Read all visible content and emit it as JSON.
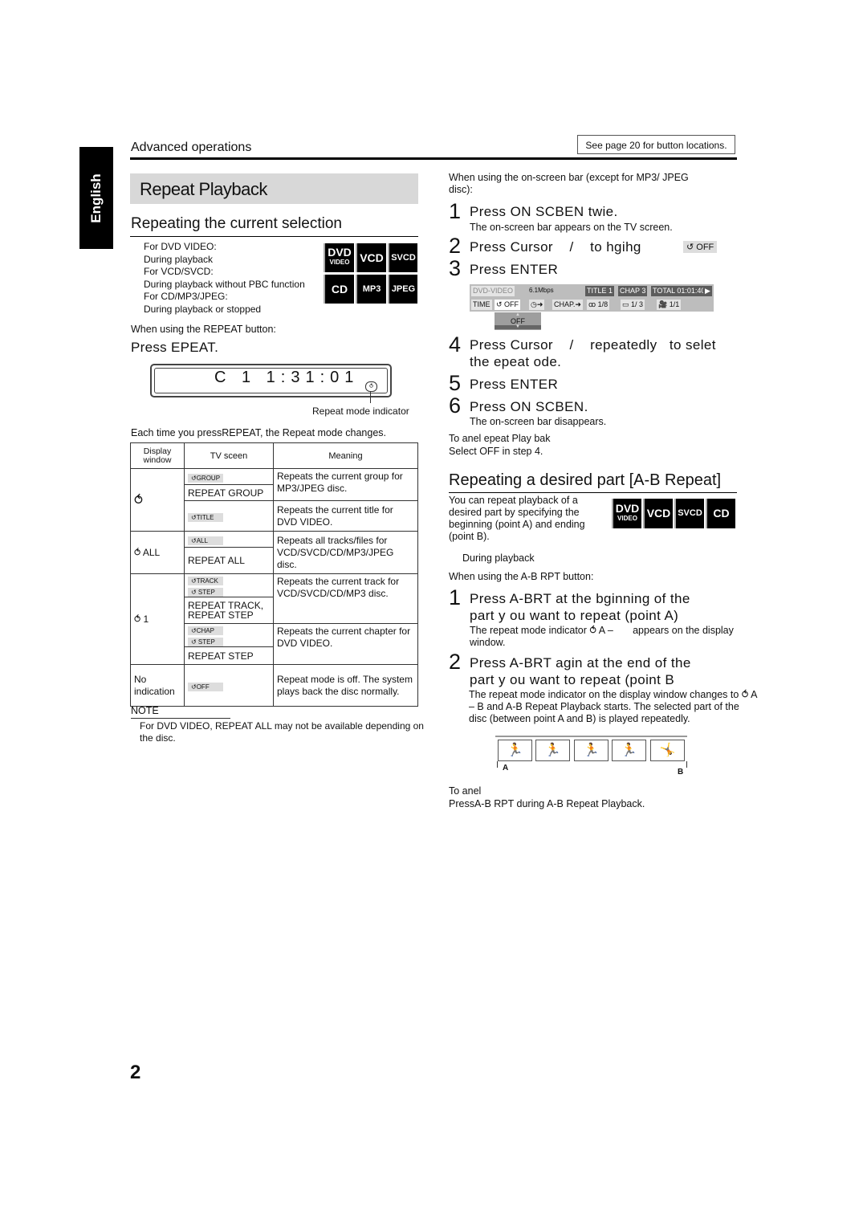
{
  "language_tab": "English",
  "section": "Advanced operations",
  "see_page_note": "See page 20 for button locations.",
  "page_title": "Repeat Playback",
  "page_number": "2",
  "left": {
    "heading": "Repeating the current selection",
    "conditions": [
      "For DVD VIDEO:",
      "During playback",
      "For VCD/SVCD:",
      "During playback without PBC function",
      "For CD/MP3/JPEG:",
      "During playback or stopped"
    ],
    "disc_badges": [
      {
        "main": "DVD",
        "sub": "VIDEO"
      },
      {
        "main": "VCD",
        "sub": ""
      },
      {
        "main": "SVCD",
        "sub": ""
      },
      {
        "main": "CD",
        "sub": ""
      },
      {
        "main": "MP3",
        "sub": ""
      },
      {
        "main": "JPEG",
        "sub": ""
      }
    ],
    "when_using": "When using the REPEAT button:",
    "press_repeat": "Press EPEAT.",
    "lcd_text": "C 1 1:31:01",
    "lcd_indicator_label": "Repeat mode indicator",
    "each_time": "Each time you pressREPEAT, the Repeat mode changes.",
    "table": {
      "headers": [
        "Display window",
        "TV sceen",
        "Meaning"
      ],
      "groups": [
        {
          "display": "⥀",
          "rows": [
            {
              "tv_chip": "↺GROUP",
              "tv_text": "REPEAT GROUP",
              "meaning": "Repeats the current group for MP3/JPEG disc."
            },
            {
              "tv_chip": "↺TITLE",
              "tv_text": "",
              "meaning": "Repeats the current title for DVD VIDEO."
            }
          ]
        },
        {
          "display": "⥀ ALL",
          "rows": [
            {
              "tv_chip": "↺ALL",
              "tv_text": "REPEAT ALL",
              "meaning": "Repeats all tracks/files for VCD/SVCD/CD/MP3/JPEG disc."
            }
          ]
        },
        {
          "display": "⥀ 1",
          "rows": [
            {
              "tv_chip": "↺TRACK",
              "tv_chip2": "↺ STEP",
              "tv_text": "REPEAT TRACK, REPEAT STEP",
              "meaning": "Repeats the current track for VCD/SVCD/CD/MP3 disc."
            },
            {
              "tv_chip": "↺CHAP",
              "tv_chip2": "↺ STEP",
              "tv_text": "REPEAT STEP",
              "meaning": "Repeats the current chapter for DVD VIDEO."
            }
          ]
        },
        {
          "display": "No indication",
          "rows": [
            {
              "tv_chip": "↺OFF",
              "tv_text": "",
              "meaning": "Repeat mode is off. The system plays back the disc normally."
            }
          ]
        }
      ]
    },
    "note_label": "NOTE",
    "note_text": "For DVD VIDEO, REPEAT ALL may not be available depending on the disc."
  },
  "right": {
    "intro": "When using the on-screen bar (except for MP3/ JPEG disc):",
    "steps": [
      {
        "num": "1",
        "text": "Press ON SCBEN twie.",
        "sub": "The on-screen bar appears on the TV screen."
      },
      {
        "num": "2",
        "text": "Press Cursor    /    to hgihg",
        "chip": "↺ OFF"
      },
      {
        "num": "3",
        "text": "Press ENTER"
      },
      {
        "num": "4",
        "text": "Press Cursor    /    repeatedly   to selet",
        "text2": "the epeat ode."
      },
      {
        "num": "5",
        "text": "Press ENTER"
      },
      {
        "num": "6",
        "text": "Press ON SCBEN.",
        "sub": "The on-screen bar disappears."
      }
    ],
    "osd": {
      "disc": "DVD-VIDEO",
      "rate": "6.1Mbps",
      "title": "TITLE  1",
      "chap": "CHAP  3",
      "total": "TOTAL 01:01:40",
      "row2": [
        "TIME",
        "↺ OFF",
        "◷➜",
        "CHAP.➜",
        "ꝏ 1/8",
        "▭ 1/ 3",
        "🎥 1/1"
      ],
      "dropdown": "OFF"
    },
    "cancel_label": "To anel epeat Play bak",
    "cancel_text": "Select  OFF  in step 4.",
    "ab_heading": "Repeating a desired part [A-B Repeat]",
    "ab_intro": "You can repeat playback of a desired part by specifying the beginning (point A) and ending (point B).",
    "ab_badges": [
      {
        "main": "DVD",
        "sub": "VIDEO"
      },
      {
        "main": "VCD",
        "sub": ""
      },
      {
        "main": "SVCD",
        "sub": ""
      },
      {
        "main": "CD",
        "sub": ""
      }
    ],
    "ab_condition": "During playback",
    "ab_when": "When using the A-B RPT button:",
    "ab_steps": [
      {
        "num": "1",
        "line1": "Press A-BRT at the bginning of the",
        "line2": "part y ou want to repeat (point A)",
        "sub": "The repeat mode indicator ⥀ A –       appears on the display window."
      },
      {
        "num": "2",
        "line1": "Press A-BRT agin at the end of the",
        "line2": "part y ou want to repeat (point B",
        "sub": "The repeat mode indicator on the display window changes to ⥀ A – B  and A-B Repeat Playback starts. The selected part of the disc (between point A and B) is played repeatedly."
      }
    ],
    "film_point_a": "A",
    "film_point_b": "B",
    "ab_cancel_label": "To anel",
    "ab_cancel_text": "PressA-B RPT during A-B Repeat Playback."
  }
}
